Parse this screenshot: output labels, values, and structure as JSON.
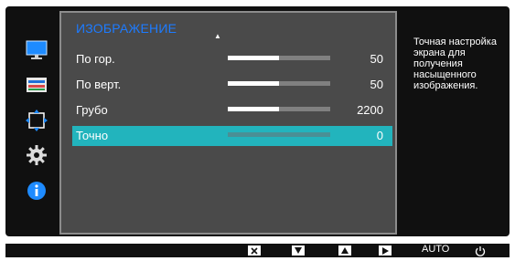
{
  "osd": {
    "title": "ИЗОБРАЖЕНИЕ",
    "items": [
      {
        "label": "По гор.",
        "value": "50",
        "level": 0.5
      },
      {
        "label": "По верт.",
        "value": "50",
        "level": 0.5
      },
      {
        "label": "Грубо",
        "value": "2200",
        "level": 0.5
      },
      {
        "label": "Точно",
        "value": "0",
        "level": 0.0,
        "selected": true
      }
    ],
    "help": "Точная настройка экрана для получения насыщенного изображения."
  },
  "side_menu": [
    {
      "icon": "monitor-icon"
    },
    {
      "icon": "picture-settings-icon"
    },
    {
      "icon": "position-arrows-icon",
      "active": true
    },
    {
      "icon": "gear-icon"
    },
    {
      "icon": "info-icon"
    }
  ],
  "bottom_bar": {
    "auto_label": "AUTO"
  },
  "colors": {
    "accent_blue": "#1d7bff",
    "selected_row": "#22b4bd",
    "panel": "#4a4a4a"
  }
}
